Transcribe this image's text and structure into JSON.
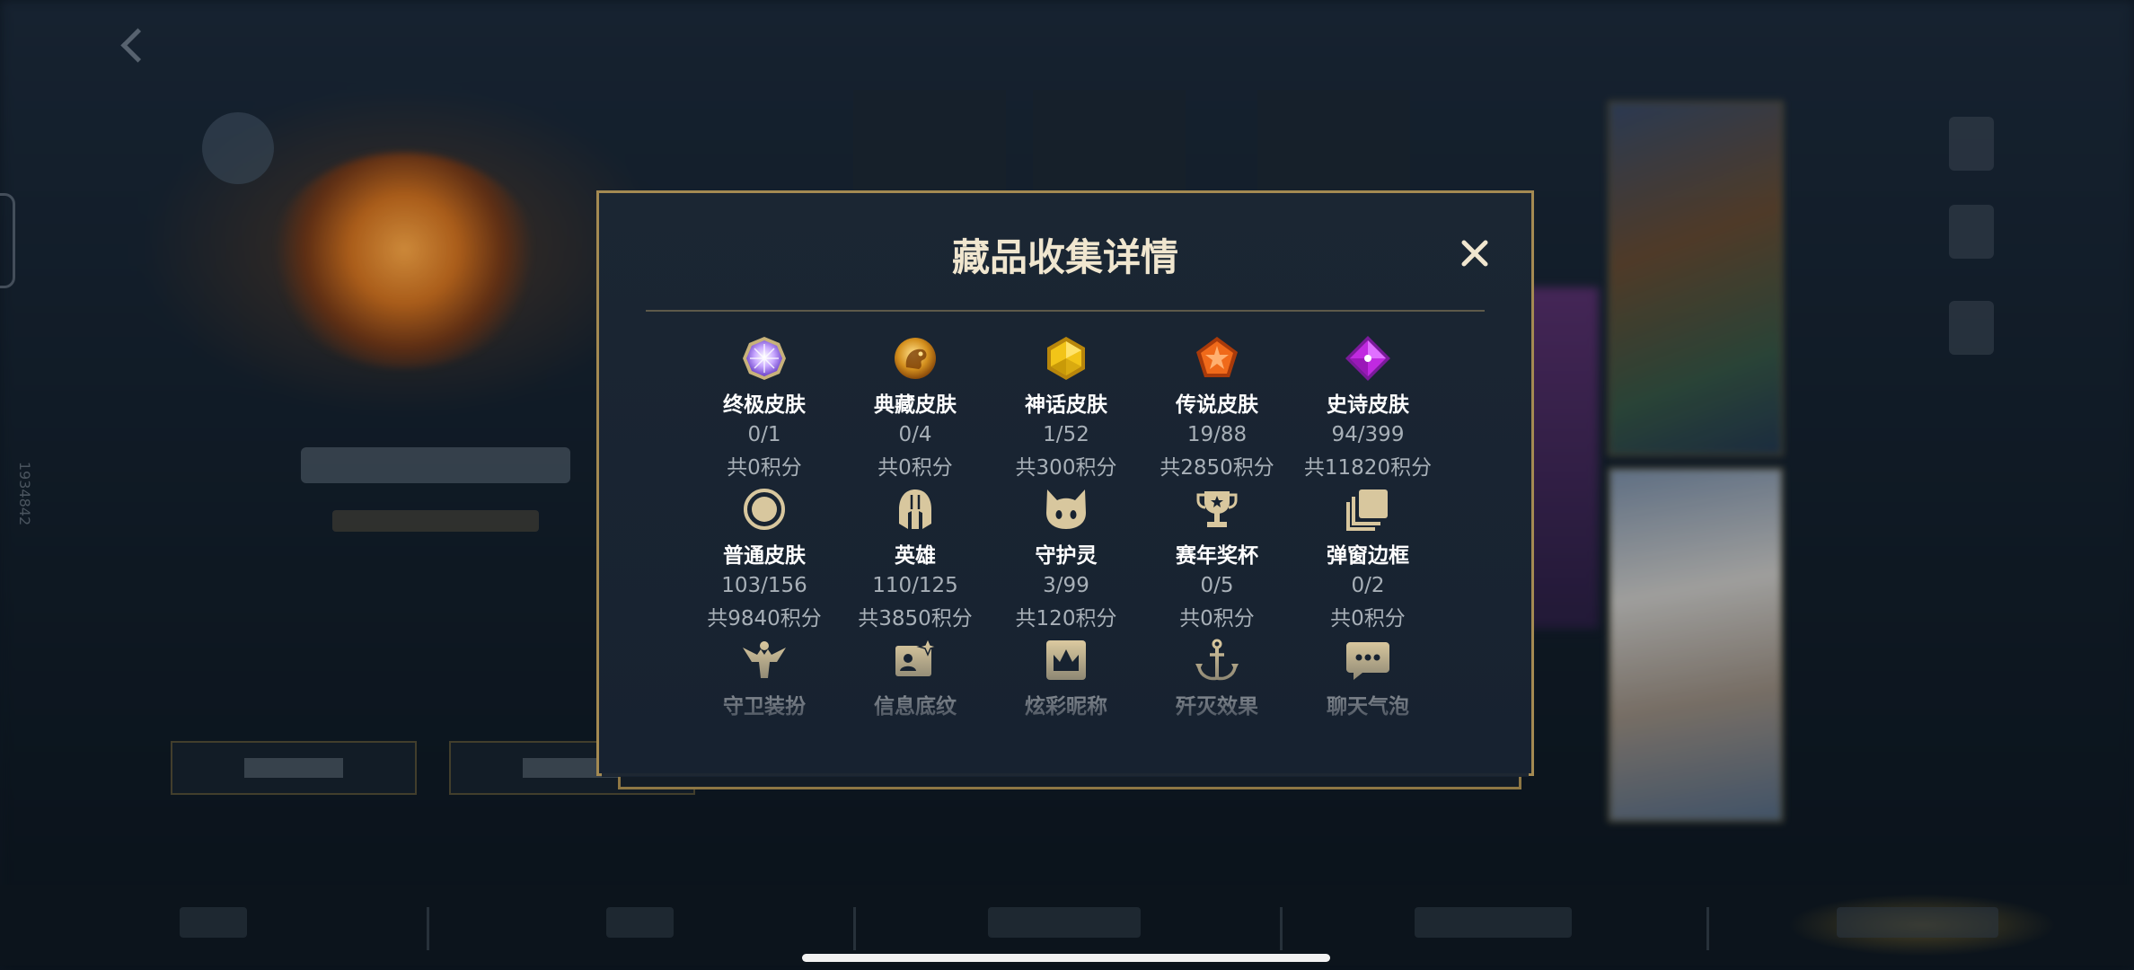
{
  "modal": {
    "title": "藏品收集详情",
    "items": [
      {
        "icon": "ultimate-skin-icon",
        "label": "终极皮肤",
        "count": "0/1",
        "points": "共0积分"
      },
      {
        "icon": "collection-skin-icon",
        "label": "典藏皮肤",
        "count": "0/4",
        "points": "共0积分"
      },
      {
        "icon": "mythic-skin-icon",
        "label": "神话皮肤",
        "count": "1/52",
        "points": "共300积分"
      },
      {
        "icon": "legendary-skin-icon",
        "label": "传说皮肤",
        "count": "19/88",
        "points": "共2850积分"
      },
      {
        "icon": "epic-skin-icon",
        "label": "史诗皮肤",
        "count": "94/399",
        "points": "共11820积分"
      },
      {
        "icon": "normal-skin-icon",
        "label": "普通皮肤",
        "count": "103/156",
        "points": "共9840积分"
      },
      {
        "icon": "hero-helmet-icon",
        "label": "英雄",
        "count": "110/125",
        "points": "共3850积分"
      },
      {
        "icon": "guardian-spirit-icon",
        "label": "守护灵",
        "count": "3/99",
        "points": "共120积分"
      },
      {
        "icon": "season-trophy-icon",
        "label": "赛年奖杯",
        "count": "0/5",
        "points": "共0积分"
      },
      {
        "icon": "popup-frame-icon",
        "label": "弹窗边框",
        "count": "0/2",
        "points": "共0积分"
      },
      {
        "icon": "guard-outfit-icon",
        "label": "守卫装扮",
        "count": "",
        "points": ""
      },
      {
        "icon": "info-background-icon",
        "label": "信息底纹",
        "count": "",
        "points": ""
      },
      {
        "icon": "colorful-nickname-icon",
        "label": "炫彩昵称",
        "count": "",
        "points": ""
      },
      {
        "icon": "kill-effect-icon",
        "label": "歼灭效果",
        "count": "",
        "points": ""
      },
      {
        "icon": "chat-bubble-icon",
        "label": "聊天气泡",
        "count": "",
        "points": ""
      }
    ]
  },
  "background": {
    "side_id": "1934842"
  },
  "colors": {
    "modal_border": "#a48a52",
    "title": "#f0e6cf",
    "label": "#ffffff",
    "subtext": "#a8b0b8",
    "icon_gold": "#d8c79e"
  }
}
